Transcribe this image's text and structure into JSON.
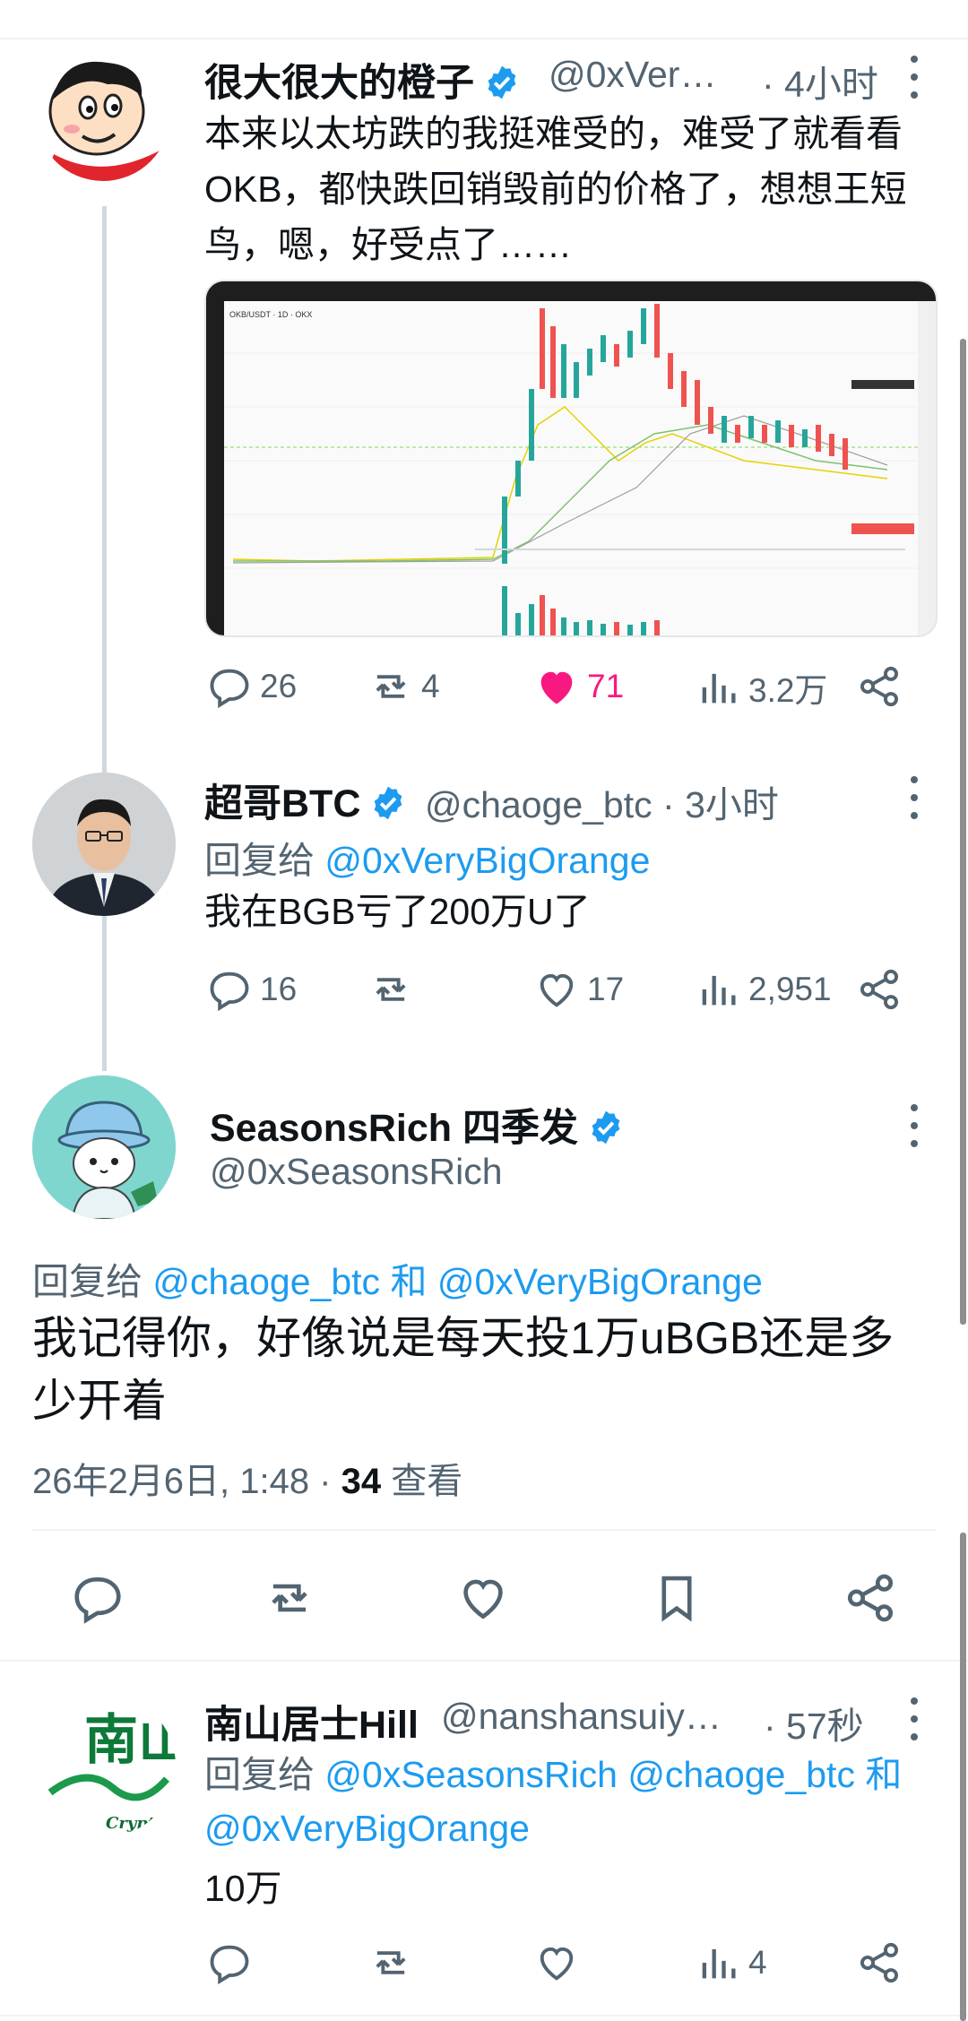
{
  "tweet1": {
    "name": "很大很大的橙子",
    "handle": "@0xVer…",
    "time": "· 4小时",
    "text": "本来以太坊跌的我挺难受的，难受了就看看OKB，都快跌回销毁前的价格了，想想王短鸟，嗯，好受点了……",
    "chart_title": "OKB/USDT · 1D · OKX",
    "stats": {
      "replies": "26",
      "retweets": "4",
      "likes": "71",
      "views": "3.2万"
    }
  },
  "tweet2": {
    "name": "超哥BTC",
    "handle": "@chaoge_btc · 3小时",
    "reply_prefix": "回复给",
    "reply_handle": "@0xVeryBigOrange",
    "text": "我在BGB亏了200万U了",
    "stats": {
      "replies": "16",
      "retweets": "",
      "likes": "17",
      "views": "2,951"
    }
  },
  "tweet3": {
    "name": "SeasonsRich 四季发",
    "handle": "@0xSeasonsRich",
    "reply_prefix": "回复给",
    "reply_handle1": "@chaoge_btc",
    "reply_and": "和",
    "reply_handle2": "@0xVeryBigOrange",
    "text": "我记得你，好像说是每天投1万uBGB还是多少开着",
    "date": "26年2月6日, 1:48 · ",
    "views_count": "34",
    "views_label": " 查看"
  },
  "tweet4": {
    "name": "南山居士Hill",
    "handle": "@nanshansuiy…",
    "time": "· 57秒",
    "reply_prefix": "回复给",
    "reply_handle1": "@0xSeasonsRich",
    "reply_handle2": "@chaoge_btc",
    "reply_and": "和",
    "reply_handle3": "@0xVeryBigOrange",
    "text": "10万",
    "stats": {
      "replies": "",
      "retweets": "",
      "likes": "",
      "views": "4"
    },
    "avatar_text": "南山",
    "avatar_sub": "Crypto"
  },
  "colors": {
    "accent": "#1d9bf0",
    "like": "#f91880",
    "muted": "#536471"
  }
}
